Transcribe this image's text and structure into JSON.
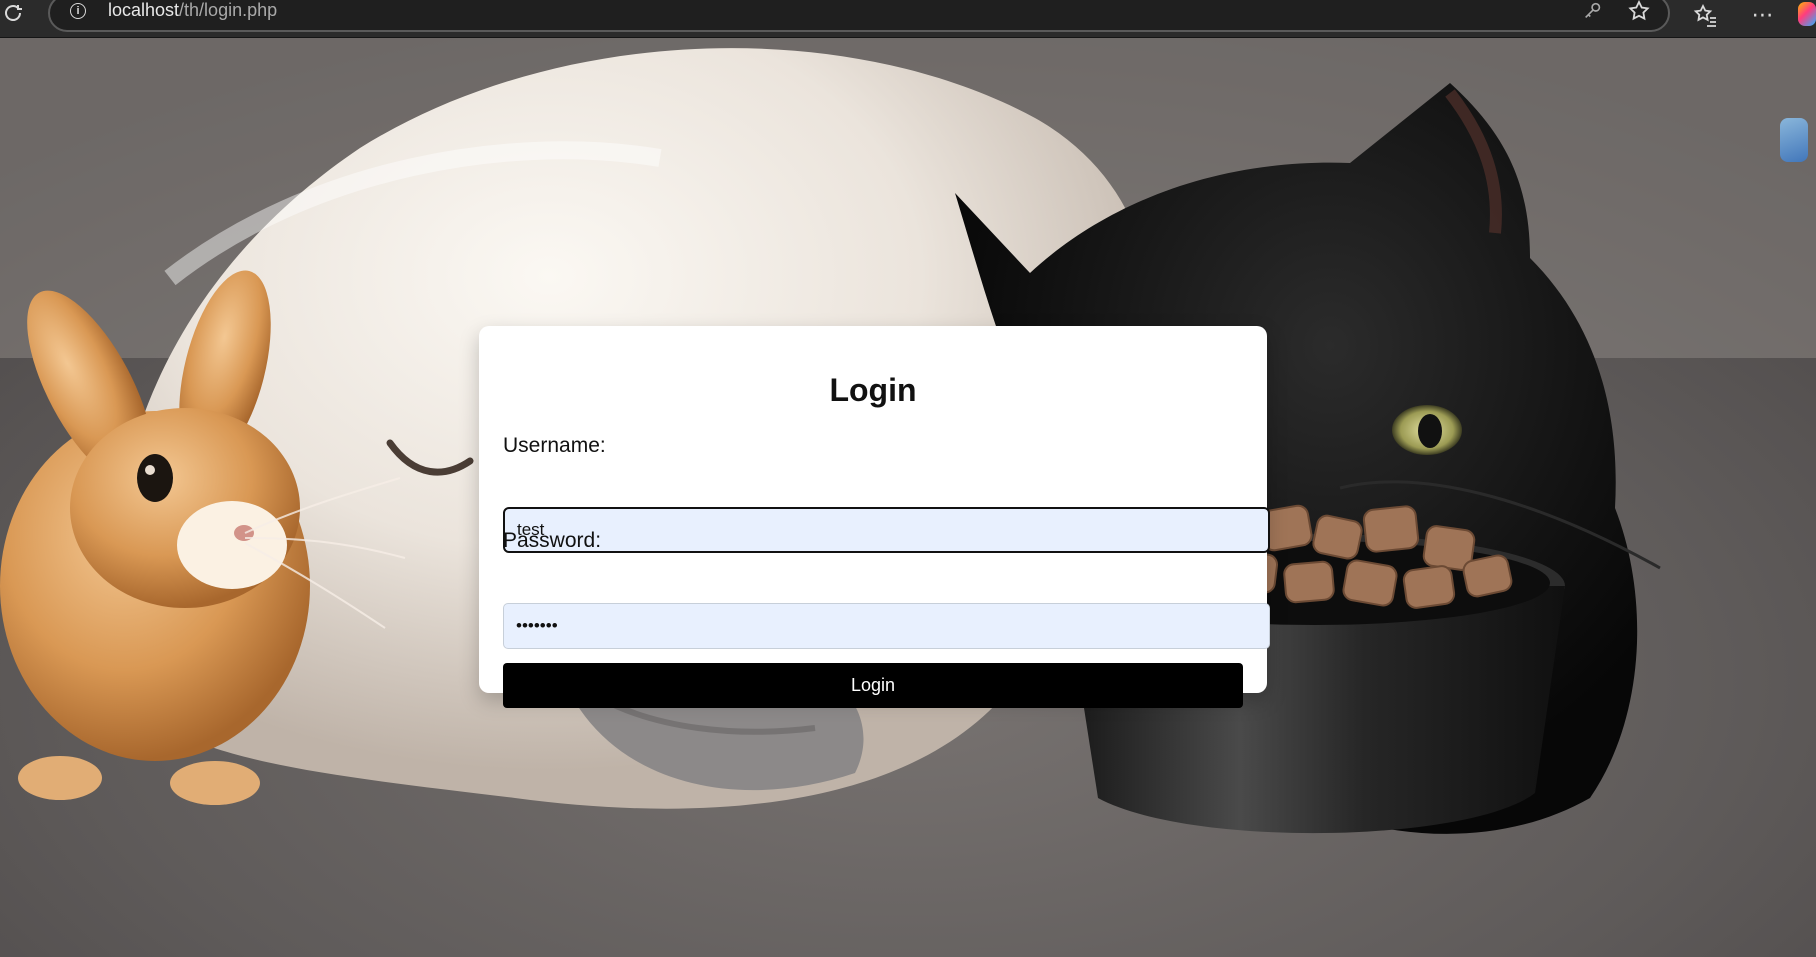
{
  "browser": {
    "url_host": "localhost",
    "url_path": "/th/login.php"
  },
  "login": {
    "title": "Login",
    "username_label": "Username:",
    "username_value": "test",
    "password_label": "Password:",
    "password_value": "•••••••",
    "button_label": "Login"
  }
}
